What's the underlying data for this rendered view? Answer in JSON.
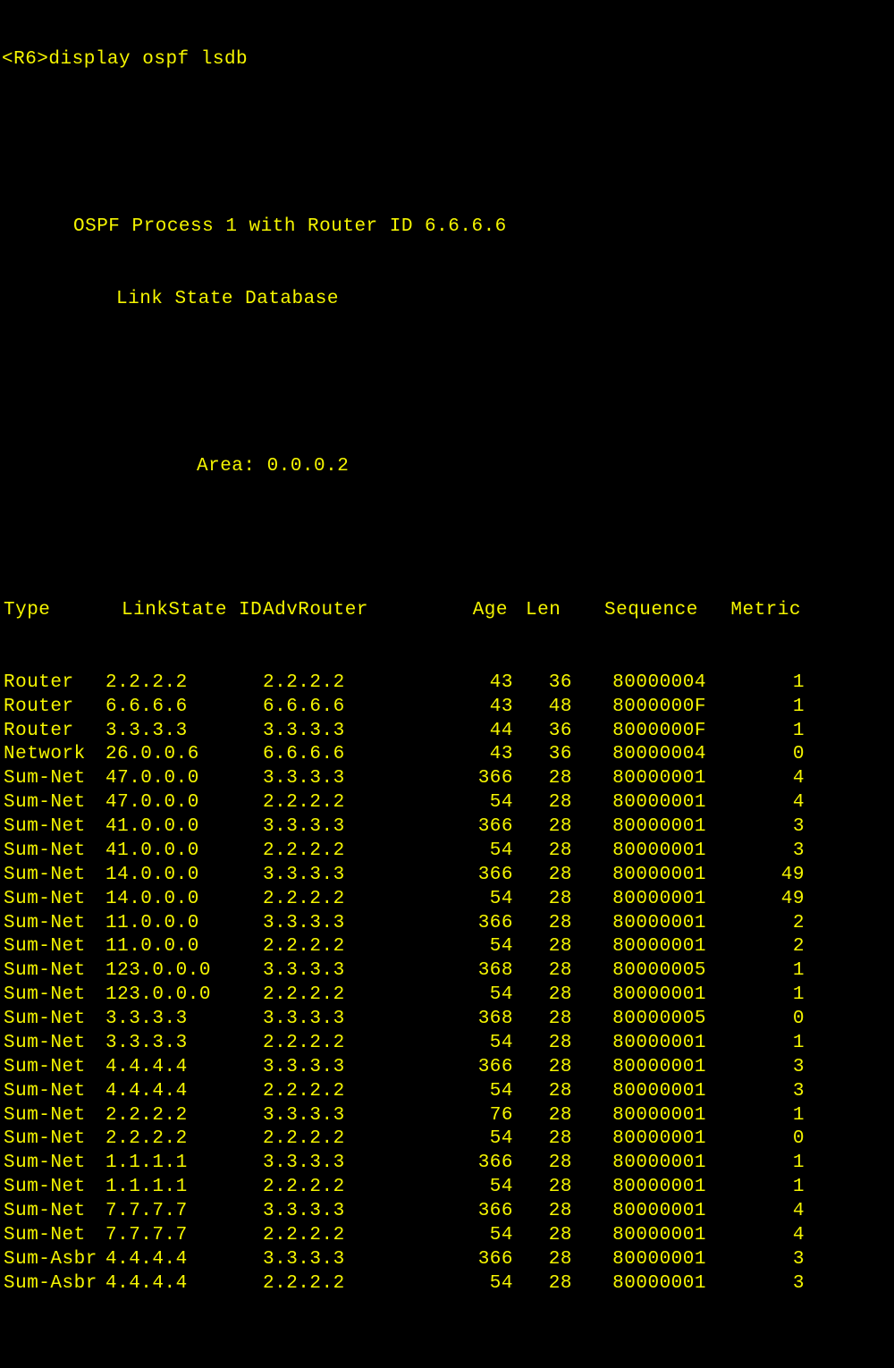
{
  "prompt": {
    "host": "<R6>",
    "command": "display ospf lsdb"
  },
  "header": {
    "process_line": "OSPF Process 1 with Router ID 6.6.6.6",
    "db_line": "Link State Database",
    "area_line": "Area: 0.0.0.2"
  },
  "columns": {
    "type": "Type",
    "lsid": "LinkState ID",
    "adv": "AdvRouter",
    "age": "Age",
    "len": "Len",
    "seq": "Sequence",
    "metric": "Metric"
  },
  "rows": [
    {
      "type": "Router",
      "lsid": "2.2.2.2",
      "adv": "2.2.2.2",
      "age": "43",
      "len": "36",
      "seq": "80000004",
      "metric": "1"
    },
    {
      "type": "Router",
      "lsid": "6.6.6.6",
      "adv": "6.6.6.6",
      "age": "43",
      "len": "48",
      "seq": "8000000F",
      "metric": "1"
    },
    {
      "type": "Router",
      "lsid": "3.3.3.3",
      "adv": "3.3.3.3",
      "age": "44",
      "len": "36",
      "seq": "8000000F",
      "metric": "1"
    },
    {
      "type": "Network",
      "lsid": "26.0.0.6",
      "adv": "6.6.6.6",
      "age": "43",
      "len": "36",
      "seq": "80000004",
      "metric": "0"
    },
    {
      "type": "Sum-Net",
      "lsid": "47.0.0.0",
      "adv": "3.3.3.3",
      "age": "366",
      "len": "28",
      "seq": "80000001",
      "metric": "4"
    },
    {
      "type": "Sum-Net",
      "lsid": "47.0.0.0",
      "adv": "2.2.2.2",
      "age": "54",
      "len": "28",
      "seq": "80000001",
      "metric": "4"
    },
    {
      "type": "Sum-Net",
      "lsid": "41.0.0.0",
      "adv": "3.3.3.3",
      "age": "366",
      "len": "28",
      "seq": "80000001",
      "metric": "3"
    },
    {
      "type": "Sum-Net",
      "lsid": "41.0.0.0",
      "adv": "2.2.2.2",
      "age": "54",
      "len": "28",
      "seq": "80000001",
      "metric": "3"
    },
    {
      "type": "Sum-Net",
      "lsid": "14.0.0.0",
      "adv": "3.3.3.3",
      "age": "366",
      "len": "28",
      "seq": "80000001",
      "metric": "49"
    },
    {
      "type": "Sum-Net",
      "lsid": "14.0.0.0",
      "adv": "2.2.2.2",
      "age": "54",
      "len": "28",
      "seq": "80000001",
      "metric": "49"
    },
    {
      "type": "Sum-Net",
      "lsid": "11.0.0.0",
      "adv": "3.3.3.3",
      "age": "366",
      "len": "28",
      "seq": "80000001",
      "metric": "2"
    },
    {
      "type": "Sum-Net",
      "lsid": "11.0.0.0",
      "adv": "2.2.2.2",
      "age": "54",
      "len": "28",
      "seq": "80000001",
      "metric": "2"
    },
    {
      "type": "Sum-Net",
      "lsid": "123.0.0.0",
      "adv": "3.3.3.3",
      "age": "368",
      "len": "28",
      "seq": "80000005",
      "metric": "1"
    },
    {
      "type": "Sum-Net",
      "lsid": "123.0.0.0",
      "adv": "2.2.2.2",
      "age": "54",
      "len": "28",
      "seq": "80000001",
      "metric": "1"
    },
    {
      "type": "Sum-Net",
      "lsid": "3.3.3.3",
      "adv": "3.3.3.3",
      "age": "368",
      "len": "28",
      "seq": "80000005",
      "metric": "0"
    },
    {
      "type": "Sum-Net",
      "lsid": "3.3.3.3",
      "adv": "2.2.2.2",
      "age": "54",
      "len": "28",
      "seq": "80000001",
      "metric": "1"
    },
    {
      "type": "Sum-Net",
      "lsid": "4.4.4.4",
      "adv": "3.3.3.3",
      "age": "366",
      "len": "28",
      "seq": "80000001",
      "metric": "3"
    },
    {
      "type": "Sum-Net",
      "lsid": "4.4.4.4",
      "adv": "2.2.2.2",
      "age": "54",
      "len": "28",
      "seq": "80000001",
      "metric": "3"
    },
    {
      "type": "Sum-Net",
      "lsid": "2.2.2.2",
      "adv": "3.3.3.3",
      "age": "76",
      "len": "28",
      "seq": "80000001",
      "metric": "1"
    },
    {
      "type": "Sum-Net",
      "lsid": "2.2.2.2",
      "adv": "2.2.2.2",
      "age": "54",
      "len": "28",
      "seq": "80000001",
      "metric": "0"
    },
    {
      "type": "Sum-Net",
      "lsid": "1.1.1.1",
      "adv": "3.3.3.3",
      "age": "366",
      "len": "28",
      "seq": "80000001",
      "metric": "1"
    },
    {
      "type": "Sum-Net",
      "lsid": "1.1.1.1",
      "adv": "2.2.2.2",
      "age": "54",
      "len": "28",
      "seq": "80000001",
      "metric": "1"
    },
    {
      "type": "Sum-Net",
      "lsid": "7.7.7.7",
      "adv": "3.3.3.3",
      "age": "366",
      "len": "28",
      "seq": "80000001",
      "metric": "4"
    },
    {
      "type": "Sum-Net",
      "lsid": "7.7.7.7",
      "adv": "2.2.2.2",
      "age": "54",
      "len": "28",
      "seq": "80000001",
      "metric": "4"
    },
    {
      "type": "Sum-Asbr",
      "lsid": "4.4.4.4",
      "adv": "3.3.3.3",
      "age": "366",
      "len": "28",
      "seq": "80000001",
      "metric": "3"
    },
    {
      "type": "Sum-Asbr",
      "lsid": "4.4.4.4",
      "adv": "2.2.2.2",
      "age": "54",
      "len": "28",
      "seq": "80000001",
      "metric": "3"
    }
  ]
}
